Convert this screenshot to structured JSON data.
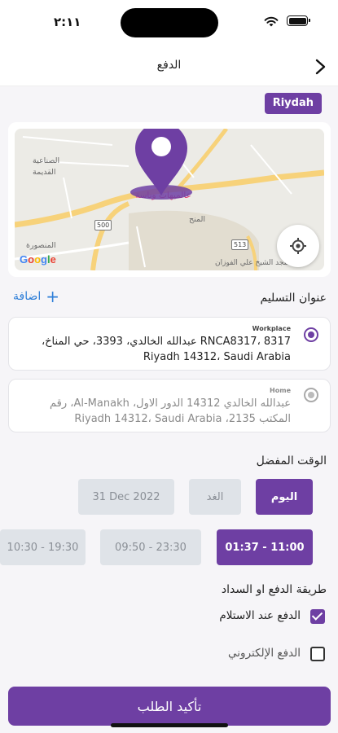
{
  "status_bar": {
    "time": "٢:١١"
  },
  "header": {
    "title": "الدفع"
  },
  "city_badge": "Riydah",
  "map": {
    "labels": [
      "الصناعية",
      "القديمة",
      "المنصورة",
      "عالميهات وناسة",
      "المنح",
      "مسجد الشيخ علي الفوزان"
    ],
    "road_badges": [
      "500",
      "513"
    ],
    "google_logo": "Google",
    "colors": {
      "roads": "#f7d27a",
      "pin": "#6e3fa3"
    }
  },
  "delivery": {
    "title": "عنوان التسليم",
    "add_label": "اضافة",
    "addresses": [
      {
        "tag": "Workplace",
        "text": "RNCA8317، 8317 عبدالله الخالدي، 3393، حي المناخ، Riyadh 14312، Saudi Arabia",
        "selected": true
      },
      {
        "tag": "Home",
        "text": "عبدالله الخالدي 14312 الدور الاول، Al-Manakh، رقم المكتب 2135، Riyadh 14312، Saudi Arabia",
        "selected": false
      }
    ]
  },
  "preferred_time": {
    "title": "الوقت المفضل",
    "days": [
      {
        "label": "اليوم",
        "active": true
      },
      {
        "label": "الغد",
        "active": false
      },
      {
        "label": "31 Dec 2022",
        "active": false
      }
    ],
    "slots": [
      {
        "label": "01:37 - 11:00",
        "active": true
      },
      {
        "label": "09:50 - 23:30",
        "active": false
      },
      {
        "label": "10:30 - 19:30",
        "active": false
      }
    ]
  },
  "payment": {
    "title": "طريقة الدفع او السداد",
    "options": [
      {
        "label": "الدفع عند الاستلام",
        "checked": true
      },
      {
        "label": "الدفع الإلكتروني",
        "checked": false
      }
    ]
  },
  "confirm_label": "تأكيد الطلب",
  "theme": {
    "accent": "#6e3fa3",
    "link": "#2f7fd8"
  }
}
